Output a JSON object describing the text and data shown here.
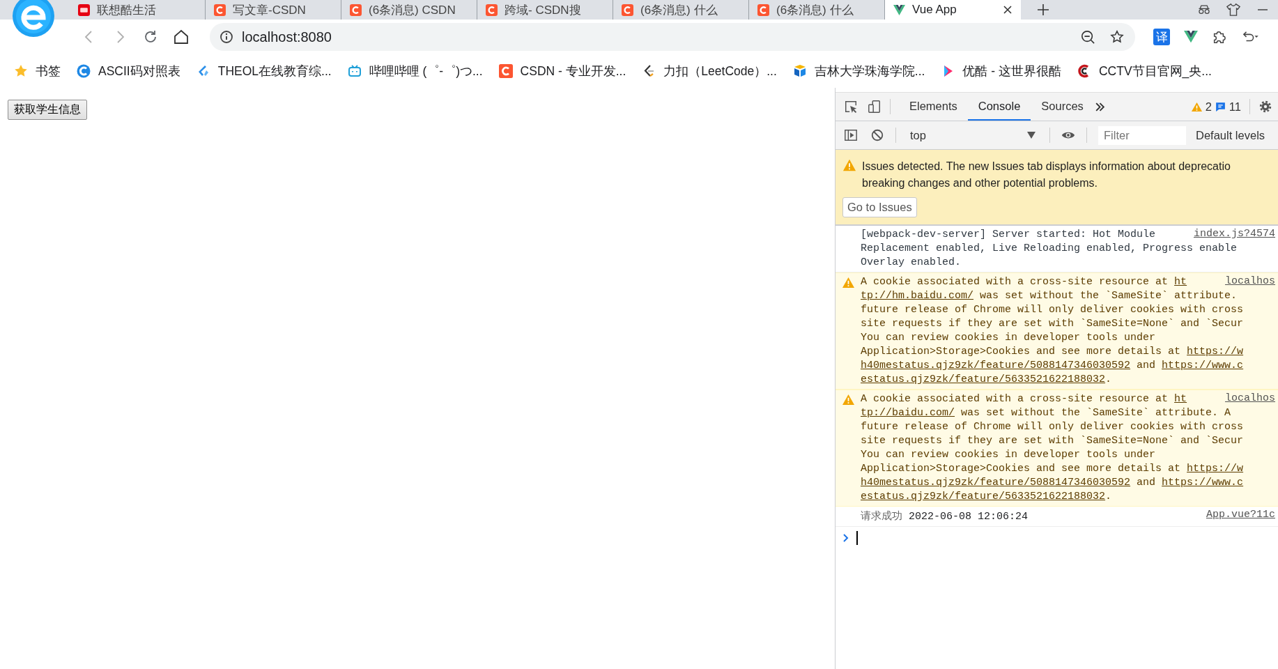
{
  "browser": {
    "tabs": [
      {
        "title": "联想酷生活",
        "selected": false
      },
      {
        "title": "写文章-CSDN",
        "selected": false
      },
      {
        "title": "(6条消息) CSDN",
        "selected": false
      },
      {
        "title": "跨域- CSDN搜",
        "selected": false
      },
      {
        "title": "(6条消息) 什么",
        "selected": false
      },
      {
        "title": "(6条消息) 什么",
        "selected": false
      },
      {
        "title": "Vue App",
        "selected": true
      }
    ],
    "url": "localhost:8080",
    "translate_label": "译"
  },
  "bookmarks": [
    {
      "label": "书签"
    },
    {
      "label": "ASCII码对照表"
    },
    {
      "label": "THEOL在线教育综..."
    },
    {
      "label": "哔哩哔哩 (゜-゜)つ..."
    },
    {
      "label": "CSDN - 专业开发..."
    },
    {
      "label": "力扣（LeetCode）..."
    },
    {
      "label": "吉林大学珠海学院..."
    },
    {
      "label": "优酷 - 这世界很酷"
    },
    {
      "label": "CCTV节目官网_央..."
    }
  ],
  "page": {
    "button": "获取学生信息"
  },
  "devtools": {
    "tabs": [
      {
        "label": "Elements",
        "selected": false
      },
      {
        "label": "Console",
        "selected": true
      },
      {
        "label": "Sources",
        "selected": false
      }
    ],
    "warning_count": "2",
    "message_count": "11",
    "context": "top",
    "filter_placeholder": "Filter",
    "levels": "Default levels",
    "banner": {
      "lines": [
        "Issues detected. The new Issues tab displays information about deprecatio",
        "breaking changes and other potential problems."
      ],
      "button": "Go to Issues"
    },
    "messages": [
      {
        "kind": "info",
        "source": "index.js?4574",
        "lines": [
          [
            {
              "text": "[webpack-dev-server] Server started: Hot Module",
              "link": false
            }
          ],
          [
            {
              "text": "Replacement enabled, Live Reloading enabled, Progress enable",
              "link": false
            }
          ],
          [
            {
              "text": "Overlay enabled.",
              "link": false
            }
          ]
        ]
      },
      {
        "kind": "warning",
        "source": "localhos",
        "lines": [
          [
            {
              "text": "A cookie associated with a cross-site resource at ",
              "link": false
            },
            {
              "text": "ht",
              "link": true
            }
          ],
          [
            {
              "text": "tp://hm.baidu.com/",
              "link": true
            },
            {
              "text": " was set without the `SameSite` attribute.",
              "link": false
            }
          ],
          [
            {
              "text": "future release of Chrome will only deliver cookies with cross",
              "link": false
            }
          ],
          [
            {
              "text": "site requests if they are set with `SameSite=None` and `Secur",
              "link": false
            }
          ],
          [
            {
              "text": "You can review cookies in developer tools under",
              "link": false
            }
          ],
          [
            {
              "text": "Application>Storage>Cookies and see more details at ",
              "link": false
            },
            {
              "text": "https://w",
              "link": true
            }
          ],
          [
            {
              "text": "h40mestatus.qjz9zk/feature/5088147346030592",
              "link": true
            },
            {
              "text": " and ",
              "link": false
            },
            {
              "text": "https://www.c",
              "link": true
            }
          ],
          [
            {
              "text": "estatus.qjz9zk/feature/5633521622188032",
              "link": true
            },
            {
              "text": ".",
              "link": false
            }
          ]
        ]
      },
      {
        "kind": "warning",
        "source": "localhos",
        "lines": [
          [
            {
              "text": "A cookie associated with a cross-site resource at ",
              "link": false
            },
            {
              "text": "ht",
              "link": true
            }
          ],
          [
            {
              "text": "tp://baidu.com/",
              "link": true
            },
            {
              "text": " was set without the `SameSite` attribute. A",
              "link": false
            }
          ],
          [
            {
              "text": "future release of Chrome will only deliver cookies with cross",
              "link": false
            }
          ],
          [
            {
              "text": "site requests if they are set with `SameSite=None` and `Secur",
              "link": false
            }
          ],
          [
            {
              "text": "You can review cookies in developer tools under",
              "link": false
            }
          ],
          [
            {
              "text": "Application>Storage>Cookies and see more details at ",
              "link": false
            },
            {
              "text": "https://w",
              "link": true
            }
          ],
          [
            {
              "text": "h40mestatus.qjz9zk/feature/5088147346030592",
              "link": true
            },
            {
              "text": " and ",
              "link": false
            },
            {
              "text": "https://www.c",
              "link": true
            }
          ],
          [
            {
              "text": "estatus.qjz9zk/feature/5633521622188032",
              "link": true
            },
            {
              "text": ".",
              "link": false
            }
          ]
        ]
      },
      {
        "kind": "log",
        "source": "App.vue?11c",
        "lines": [
          [
            {
              "text": "请求成功",
              "link": false
            },
            {
              "text": " 2022-06-08 12:06:24",
              "link": false
            }
          ]
        ]
      }
    ]
  }
}
